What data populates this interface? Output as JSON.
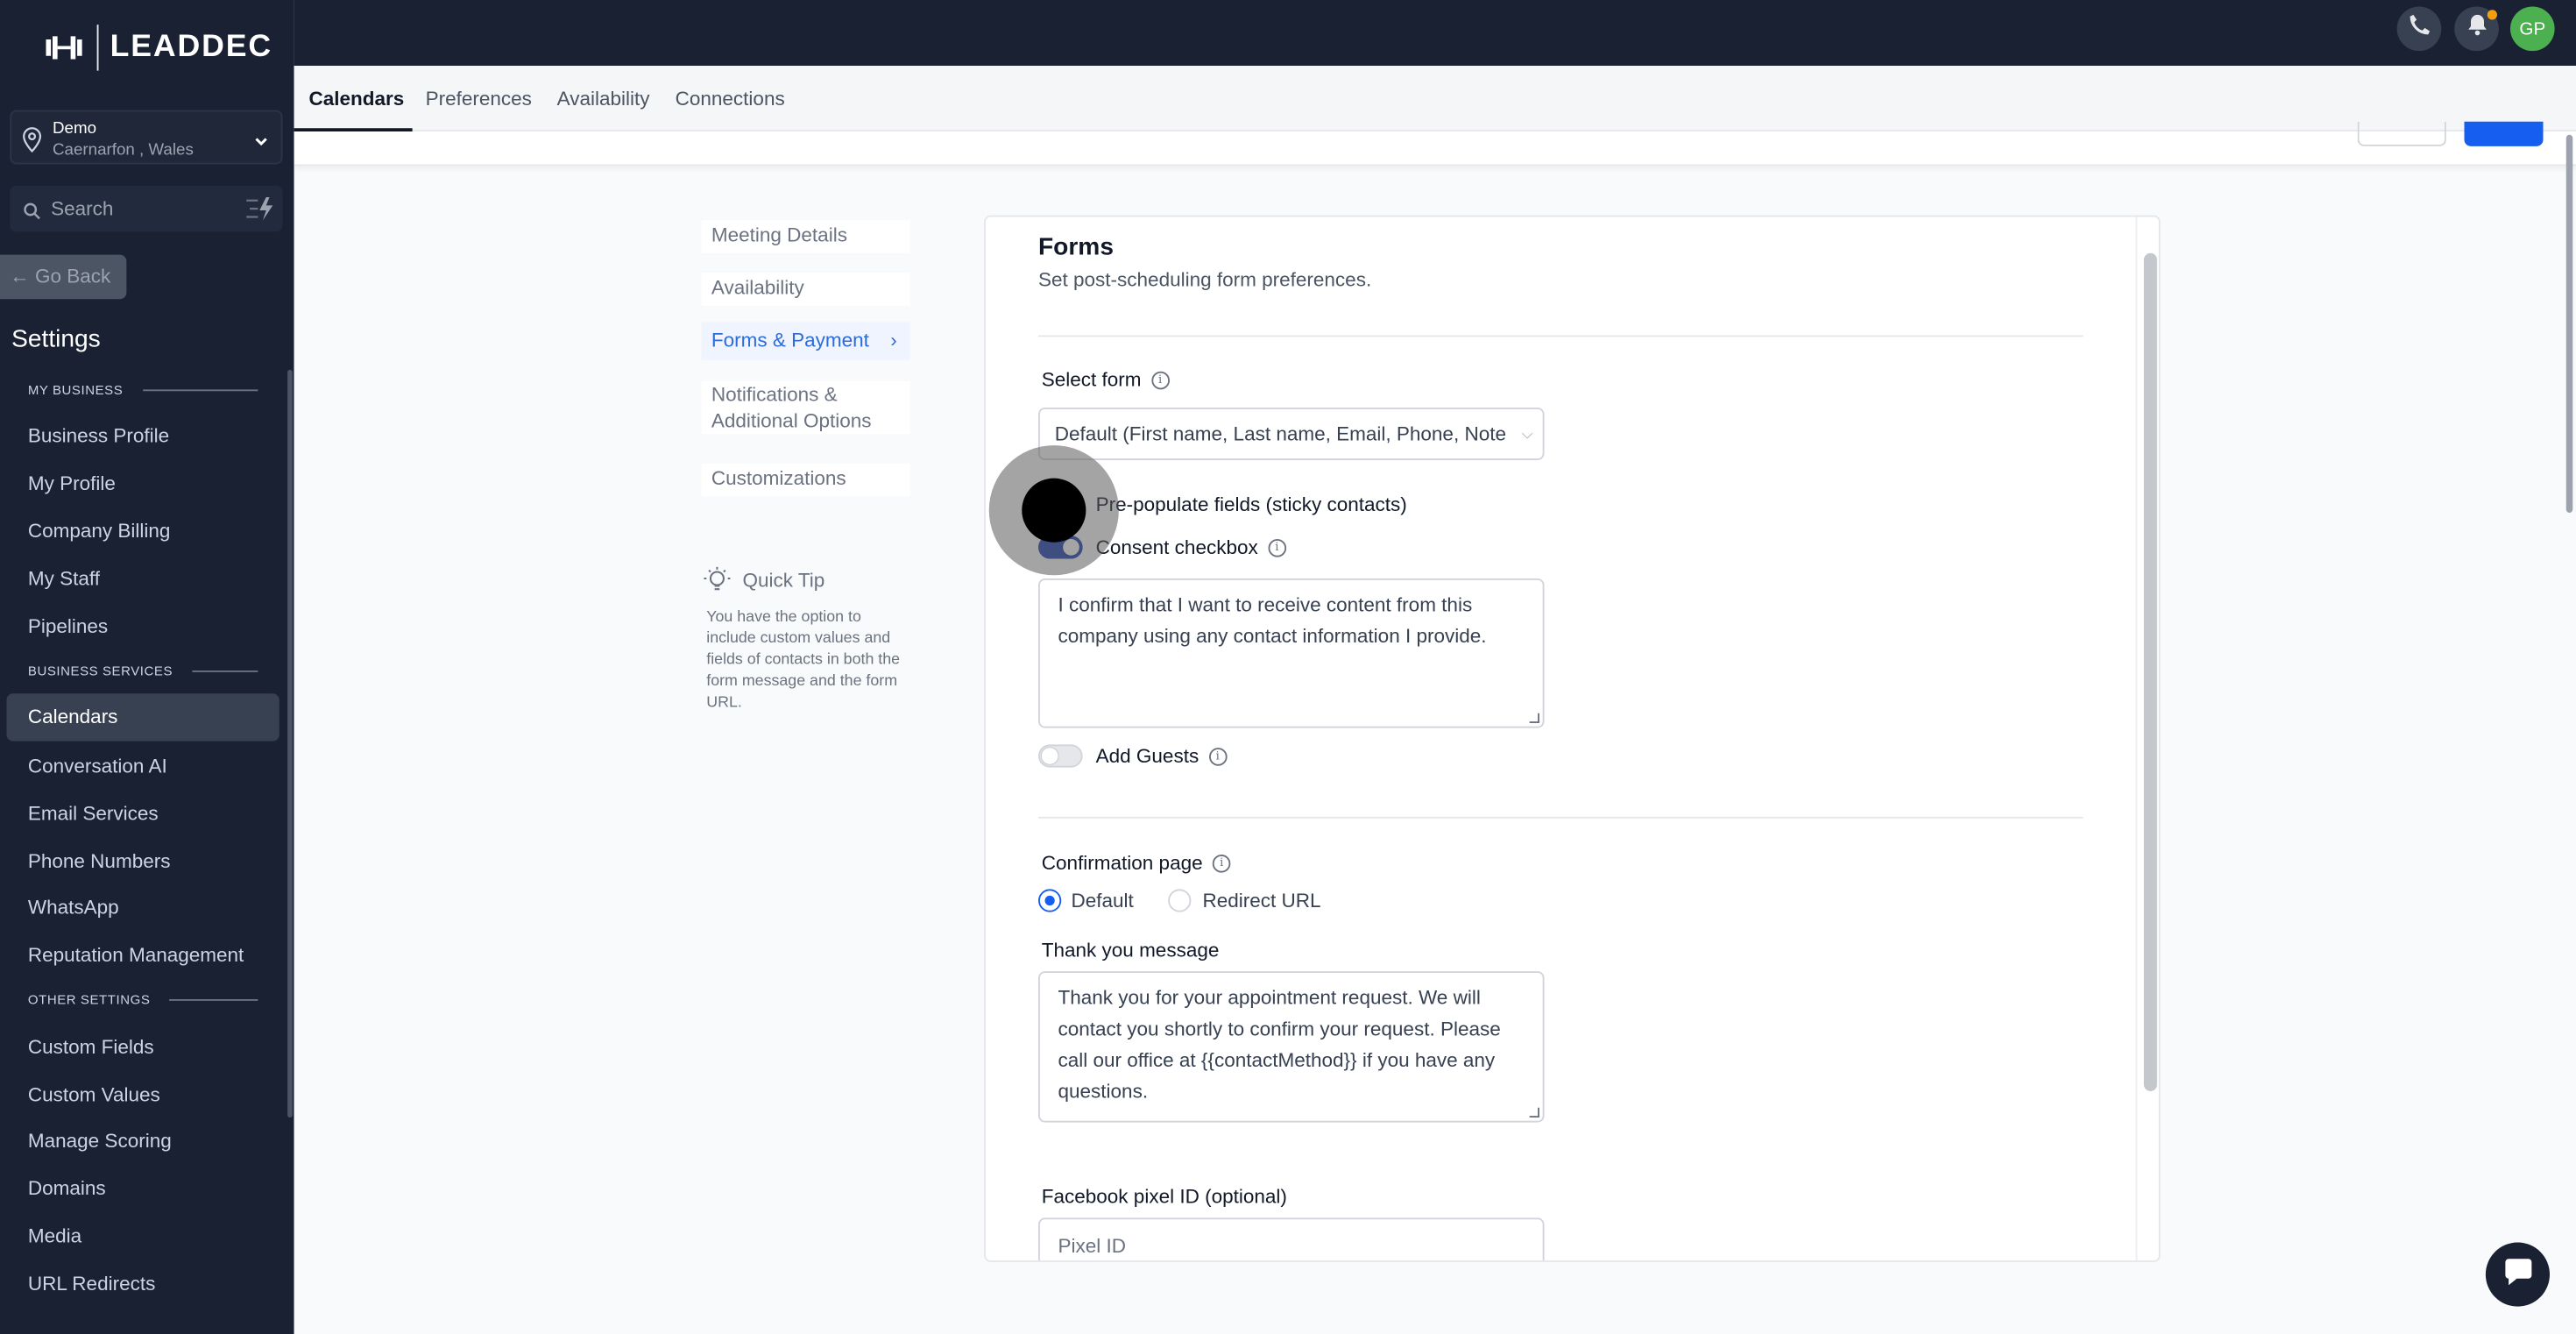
{
  "brand": {
    "name": "LEADDEC"
  },
  "location": {
    "name": "Demo",
    "place": "Caernarfon , Wales"
  },
  "search": {
    "label": "Search"
  },
  "go_back": "← Go Back",
  "settings_title": "Settings",
  "sidebar": {
    "sections": [
      {
        "title": "MY BUSINESS",
        "items": [
          "Business Profile",
          "My Profile",
          "Company Billing",
          "My Staff",
          "Pipelines"
        ]
      },
      {
        "title": "BUSINESS SERVICES",
        "items": [
          "Calendars",
          "Conversation AI",
          "Email Services",
          "Phone Numbers",
          "WhatsApp",
          "Reputation Management"
        ]
      },
      {
        "title": "OTHER SETTINGS",
        "items": [
          "Custom Fields",
          "Custom Values",
          "Manage Scoring",
          "Domains",
          "Media",
          "URL Redirects"
        ]
      }
    ],
    "active": "Calendars"
  },
  "topbar": {
    "avatar_initials": "GP",
    "colors": {
      "bg": "#1a2133",
      "avatar": "#4caf50",
      "notify_dot": "#f59e0b"
    }
  },
  "tabs": [
    "Calendars",
    "Preferences",
    "Availability",
    "Connections"
  ],
  "steps": [
    "Meeting Details",
    "Availability",
    "Forms & Payment",
    "Notifications & Additional Options",
    "Customizations"
  ],
  "active_step": "Forms & Payment",
  "quick_tip": {
    "title": "Quick Tip",
    "text": "You have the option to include custom values and fields of contacts in both the form message and the form URL."
  },
  "forms": {
    "title": "Forms",
    "subtitle": "Set post-scheduling form preferences.",
    "select_form_label": "Select form",
    "select_form_value": "Default (First name, Last name, Email, Phone, Note",
    "prepopulate_label": "Pre-populate fields (sticky contacts)",
    "consent_label": "Consent checkbox",
    "consent_enabled": true,
    "consent_text": "I confirm that I want to receive content from this company using any contact information I provide.",
    "add_guests_label": "Add Guests",
    "add_guests_enabled": false,
    "confirmation_label": "Confirmation page",
    "confirmation_options": [
      "Default",
      "Redirect URL"
    ],
    "confirmation_selected": "Default",
    "thank_you_label": "Thank you message",
    "thank_you_text": "Thank you for your appointment request. We will contact you shortly to confirm your request. Please call our office at {{contactMethod}} if you have any questions.",
    "pixel_label": "Facebook pixel ID (optional)",
    "pixel_placeholder": "Pixel ID"
  },
  "accent_color": "#155eef"
}
